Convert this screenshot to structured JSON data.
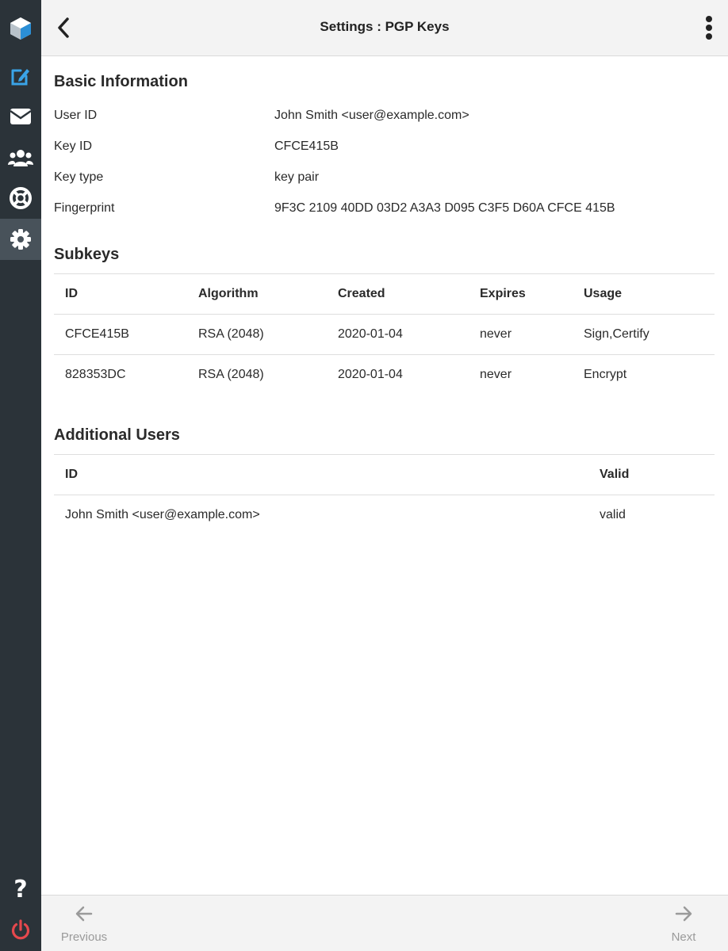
{
  "header": {
    "title": "Settings : PGP Keys"
  },
  "sidebar": {
    "items": [
      {
        "name": "logo",
        "icon": "app-logo-icon"
      },
      {
        "name": "compose",
        "icon": "edit-icon",
        "color": "#3aa4e8"
      },
      {
        "name": "mail",
        "icon": "envelope-icon"
      },
      {
        "name": "contacts",
        "icon": "users-icon"
      },
      {
        "name": "help-center",
        "icon": "lifebuoy-icon"
      },
      {
        "name": "settings",
        "icon": "gear-icon",
        "active": true
      },
      {
        "name": "help",
        "icon": "question-icon"
      },
      {
        "name": "logout",
        "icon": "power-icon",
        "color": "#e5484d"
      }
    ]
  },
  "basic_info": {
    "title": "Basic Information",
    "rows": [
      {
        "label": "User ID",
        "value": "John Smith <user@example.com>"
      },
      {
        "label": "Key ID",
        "value": "CFCE415B"
      },
      {
        "label": "Key type",
        "value": "key pair"
      },
      {
        "label": "Fingerprint",
        "value": "9F3C 2109 40DD 03D2 A3A3 D095 C3F5 D60A CFCE 415B"
      }
    ]
  },
  "subkeys": {
    "title": "Subkeys",
    "columns": [
      "ID",
      "Algorithm",
      "Created",
      "Expires",
      "Usage"
    ],
    "rows": [
      [
        "CFCE415B",
        "RSA (2048)",
        "2020-01-04",
        "never",
        "Sign,Certify"
      ],
      [
        "828353DC",
        "RSA (2048)",
        "2020-01-04",
        "never",
        "Encrypt"
      ]
    ]
  },
  "additional_users": {
    "title": "Additional Users",
    "columns": [
      "ID",
      "Valid"
    ],
    "rows": [
      [
        "John Smith <user@example.com>",
        "valid"
      ]
    ]
  },
  "footer": {
    "previous_label": "Previous",
    "next_label": "Next"
  }
}
